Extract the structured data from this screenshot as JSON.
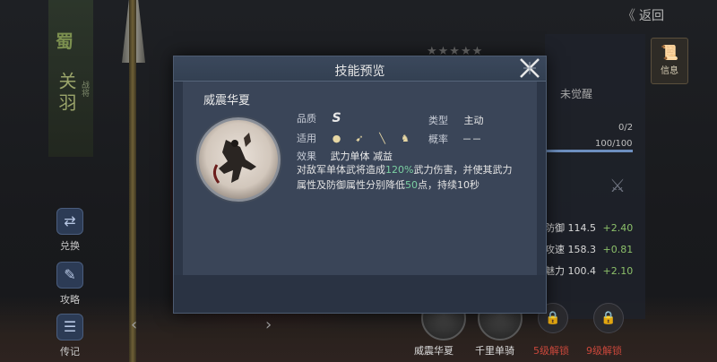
{
  "background": {
    "banner_char": "蜀",
    "hero_name": "关羽",
    "hero_tag": "战将",
    "back_label": "返回",
    "info_tab_label": "信息",
    "side_buttons": [
      {
        "label": "兑换",
        "icon": "exchange-icon"
      },
      {
        "label": "攻略",
        "icon": "guide-icon"
      },
      {
        "label": "传记",
        "icon": "biography-icon"
      }
    ],
    "awaken_text": "未觉醒",
    "progress_top": "0/2",
    "progress_bottom": "100/100",
    "progress_fraction": 1.0,
    "stats": [
      {
        "label": "防御",
        "value": "114.5",
        "bonus": "+2.40"
      },
      {
        "label": "攻速",
        "value": "158.3",
        "bonus": "+0.81"
      },
      {
        "label": "魅力",
        "value": "100.4",
        "bonus": "+2.10"
      }
    ],
    "bottom_skills": [
      {
        "label": "威震华夏"
      },
      {
        "label": "千里单骑"
      },
      {
        "label": "5级解锁"
      },
      {
        "label": "9级解锁"
      }
    ],
    "colors": {
      "locked_red": "#c9473b",
      "bonus_green": "#8cc06a"
    }
  },
  "modal": {
    "title": "技能预览",
    "skill_name": "威震华夏",
    "quality_label": "品质",
    "quality_value": "S",
    "type_label": "类型",
    "type_value": "主动",
    "apply_label": "适用",
    "apply_icons": [
      "shield-unit-icon",
      "bow-unit-icon",
      "spear-unit-icon",
      "cavalry-unit-icon"
    ],
    "rate_label": "概率",
    "rate_value": "－－",
    "effect_label": "效果",
    "effect_value": "武力单体 减益",
    "description_parts": {
      "p1": "对敌军单体武将造成",
      "n1": "120%",
      "p2": "武力伤害，并使其武力属性及防御属性分别降低",
      "n2": "50",
      "p3": "点，持续10秒"
    },
    "colors": {
      "highlight": "#7bd0a2"
    }
  }
}
